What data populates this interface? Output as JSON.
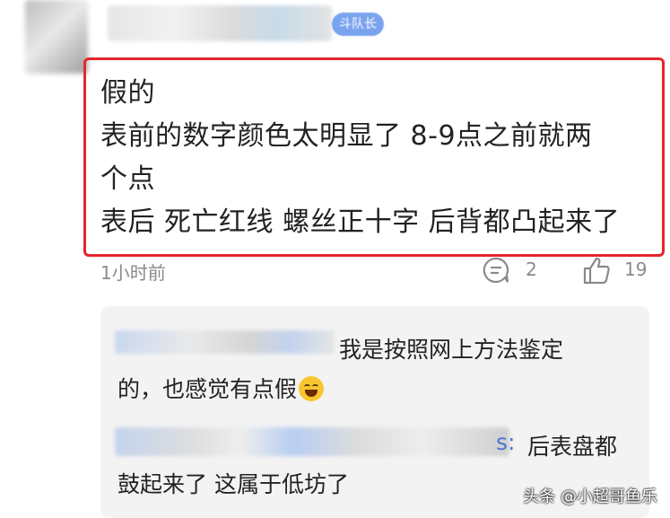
{
  "post": {
    "badge": "斗队长",
    "lines": [
      "假的",
      "表前的数字颜色太明显了 8-9点之前就两",
      "个点",
      "表后 死亡红线 螺丝正十字 后背都凸起来了"
    ],
    "time": "1小时前",
    "reply_count": "2",
    "like_count": "19"
  },
  "replies": [
    {
      "text_line1": "我是按照网上方法鉴定",
      "text_line2": "的，也感觉有点假"
    },
    {
      "suffix": "s:",
      "text_line1": "后表盘都",
      "text_line2": "鼓起来了 这属于低坊了"
    }
  ],
  "watermark": "头条 @小超哥鱼乐",
  "colors": {
    "highlight_border": "#e5262d",
    "badge_bg": "#7aa3ee",
    "reply_bg": "#f3f3f3",
    "mention_blue": "#4a78d0"
  }
}
